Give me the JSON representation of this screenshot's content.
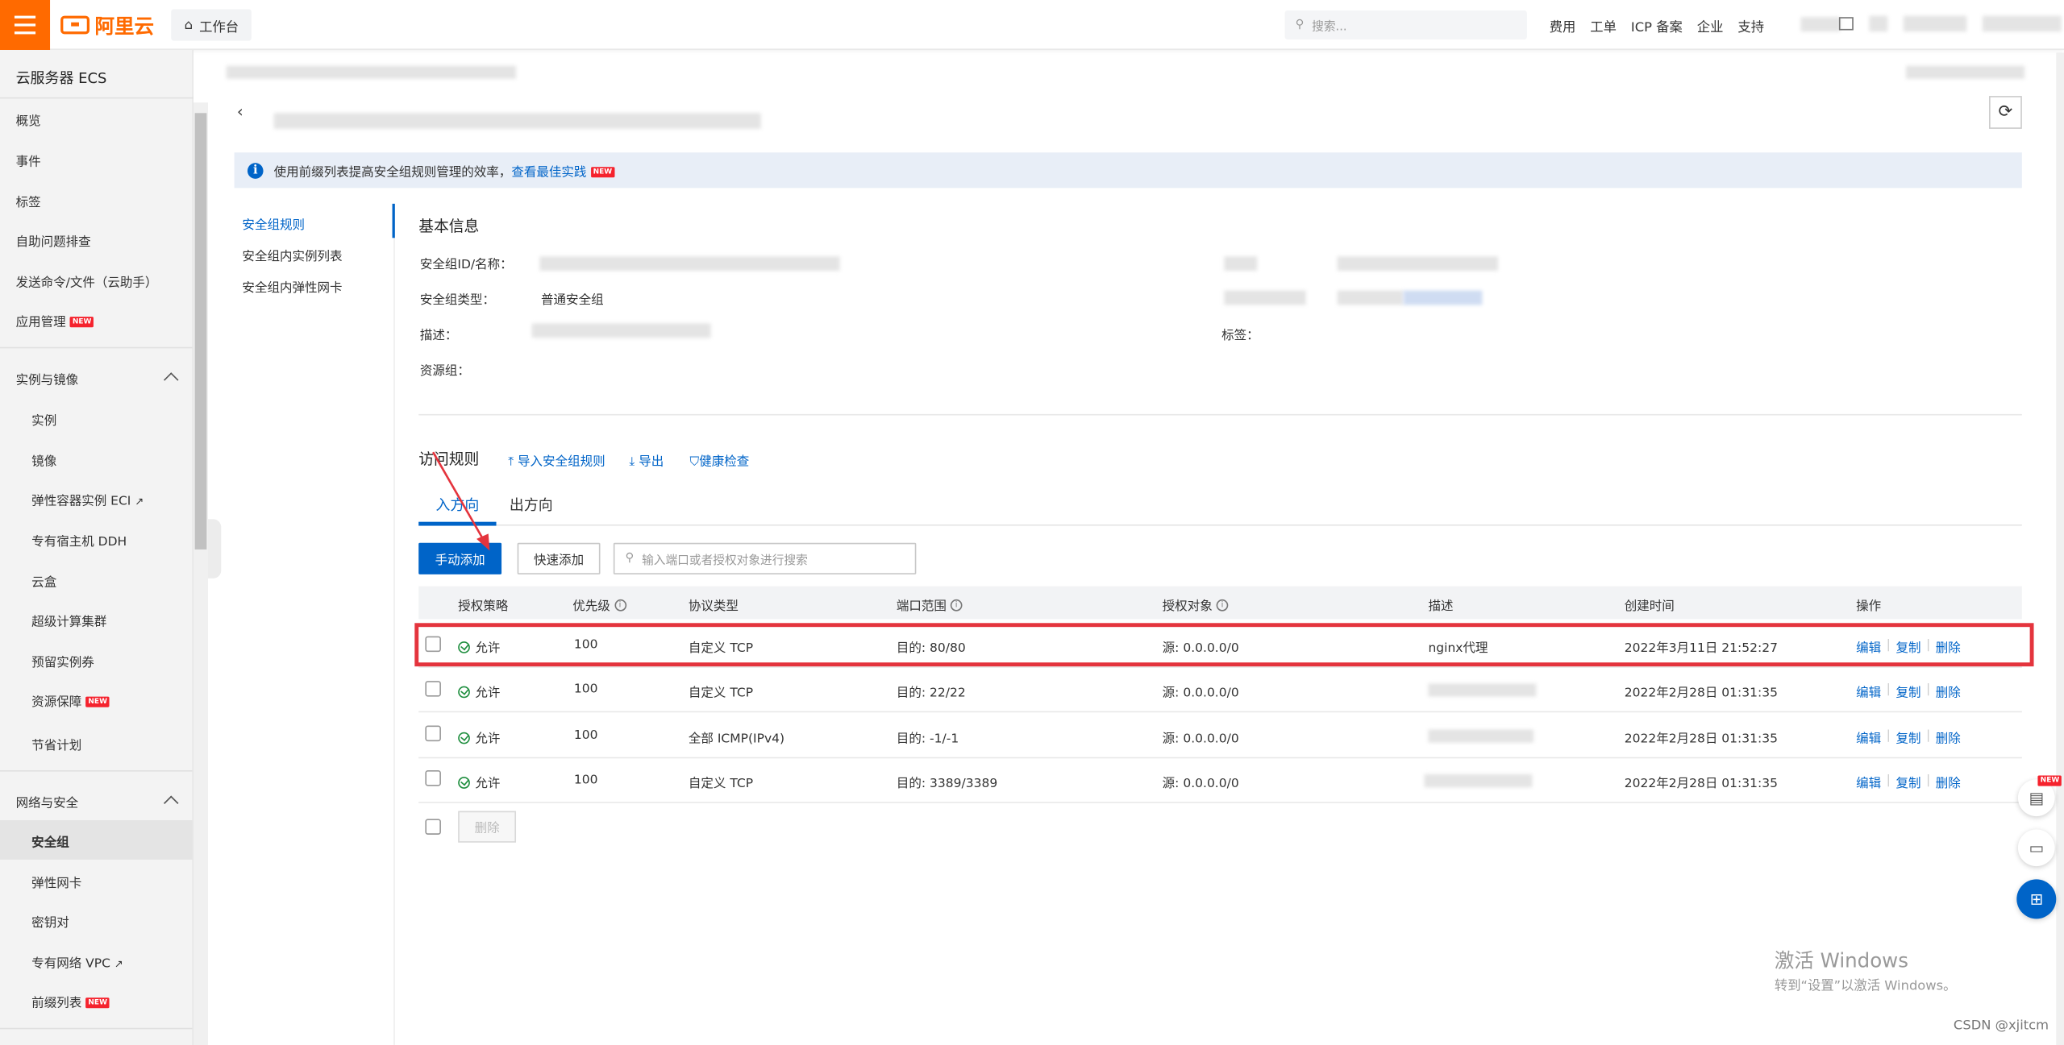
{
  "header": {
    "logo_text": "阿里云",
    "workbench": "工作台",
    "search_placeholder": "搜索...",
    "nav": [
      "费用",
      "工单",
      "ICP 备案",
      "企业",
      "支持"
    ]
  },
  "sidebar": {
    "title": "云服务器 ECS",
    "top_items": [
      "概览",
      "事件",
      "标签",
      "自助问题排查",
      "发送命令/文件（云助手）",
      "应用管理"
    ],
    "group1": {
      "title": "实例与镜像",
      "items": [
        "实例",
        "镜像",
        "弹性容器实例 ECI",
        "专有宿主机 DDH",
        "云盒",
        "超级计算集群",
        "预留实例券",
        "资源保障",
        "节省计划"
      ]
    },
    "group2": {
      "title": "网络与安全",
      "items": [
        "安全组",
        "弹性网卡",
        "密钥对",
        "专有网络 VPC",
        "前缀列表"
      ]
    },
    "badge": "NEW"
  },
  "notice": {
    "text": "使用前缀列表提高安全组规则管理的效率，",
    "link": "查看最佳实践"
  },
  "left_nav": [
    "安全组规则",
    "安全组内实例列表",
    "安全组内弹性网卡"
  ],
  "basic_info": {
    "title": "基本信息",
    "id_label": "安全组ID/名称：",
    "type_label": "安全组类型：",
    "type_value": "普通安全组",
    "desc_label": "描述：",
    "rg_label": "资源组：",
    "tag_label": "标签："
  },
  "rules": {
    "title": "访问规则",
    "import": "导入安全组规则",
    "export": "导出",
    "health": "健康检查",
    "tabs": [
      "入方向",
      "出方向"
    ],
    "btn_manual": "手动添加",
    "btn_quick": "快速添加",
    "search_placeholder": "输入端口或者授权对象进行搜索",
    "columns": [
      "授权策略",
      "优先级",
      "协议类型",
      "端口范围",
      "授权对象",
      "描述",
      "创建时间",
      "操作"
    ],
    "rows": [
      {
        "policy": "允许",
        "priority": "100",
        "protocol": "自定义 TCP",
        "port": "目的: 80/80",
        "source": "源: 0.0.0.0/0",
        "desc": "nginx代理",
        "created": "2022年3月11日 21:52:27"
      },
      {
        "policy": "允许",
        "priority": "100",
        "protocol": "自定义 TCP",
        "port": "目的: 22/22",
        "source": "源: 0.0.0.0/0",
        "desc": "",
        "created": "2022年2月28日 01:31:35"
      },
      {
        "policy": "允许",
        "priority": "100",
        "protocol": "全部 ICMP(IPv4)",
        "port": "目的: -1/-1",
        "source": "源: 0.0.0.0/0",
        "desc": "",
        "created": "2022年2月28日 01:31:35"
      },
      {
        "policy": "允许",
        "priority": "100",
        "protocol": "自定义 TCP",
        "port": "目的: 3389/3389",
        "source": "源: 0.0.0.0/0",
        "desc": "",
        "created": "2022年2月28日 01:31:35"
      }
    ],
    "ops": [
      "编辑",
      "复制",
      "删除"
    ],
    "delete_btn": "删除"
  },
  "overlay": {
    "win1": "激活 Windows",
    "win2": "转到“设置”以激活 Windows。",
    "csdn": "CSDN @xjitcm",
    "float_badge": "NEW"
  }
}
